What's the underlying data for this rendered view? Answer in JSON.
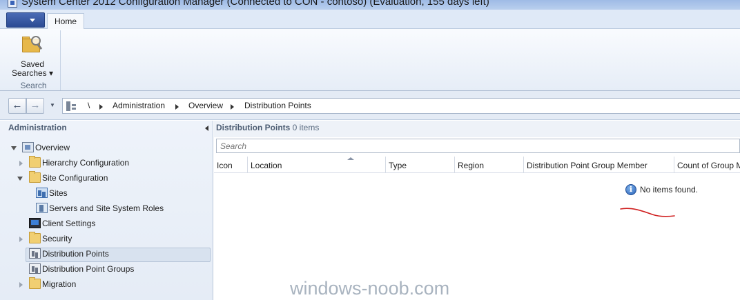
{
  "window": {
    "title": "System Center 2012 Configuration Manager (Connected to CON - contoso) (Evaluation, 155 days left)"
  },
  "ribbon": {
    "tabs": [
      {
        "label": "Home"
      }
    ],
    "groups": [
      {
        "label": "Search",
        "buttons": [
          {
            "label": "Saved Searches ▾",
            "icon": "saved-searches-icon"
          }
        ]
      }
    ]
  },
  "navigation": {
    "back_icon": "back-arrow-icon",
    "forward_icon": "forward-arrow-icon",
    "breadcrumb": [
      "\\",
      "Administration",
      "Overview",
      "Distribution Points"
    ]
  },
  "sidebar": {
    "title": "Administration",
    "items": [
      {
        "label": "Overview",
        "icon": "overview-icon",
        "level": 0,
        "expanded": true
      },
      {
        "label": "Hierarchy Configuration",
        "icon": "folder-icon",
        "level": 1,
        "expanded": false
      },
      {
        "label": "Site Configuration",
        "icon": "folder-icon",
        "level": 1,
        "expanded": true
      },
      {
        "label": "Sites",
        "icon": "sites-icon",
        "level": 2
      },
      {
        "label": "Servers and Site System Roles",
        "icon": "servers-icon",
        "level": 2
      },
      {
        "label": "Client Settings",
        "icon": "client-settings-icon",
        "level": 1
      },
      {
        "label": "Security",
        "icon": "folder-icon",
        "level": 1,
        "expanded": false
      },
      {
        "label": "Distribution Points",
        "icon": "distribution-points-icon",
        "level": 1,
        "selected": true
      },
      {
        "label": "Distribution Point Groups",
        "icon": "distribution-point-groups-icon",
        "level": 1
      },
      {
        "label": "Migration",
        "icon": "folder-icon",
        "level": 1,
        "expanded": false
      }
    ]
  },
  "main": {
    "title": "Distribution Points",
    "count": "0 items",
    "search_placeholder": "Search",
    "columns": [
      "Icon",
      "Location",
      "Type",
      "Region",
      "Distribution Point Group Member",
      "Count of Group M"
    ],
    "empty_message": "No items found."
  },
  "watermark": "windows-noob.com",
  "colors": {
    "accent": "#2c4b93",
    "title_bar": "#a9c2ea",
    "pane_background": "#e8eef7",
    "annotation_red": "#d02020"
  }
}
